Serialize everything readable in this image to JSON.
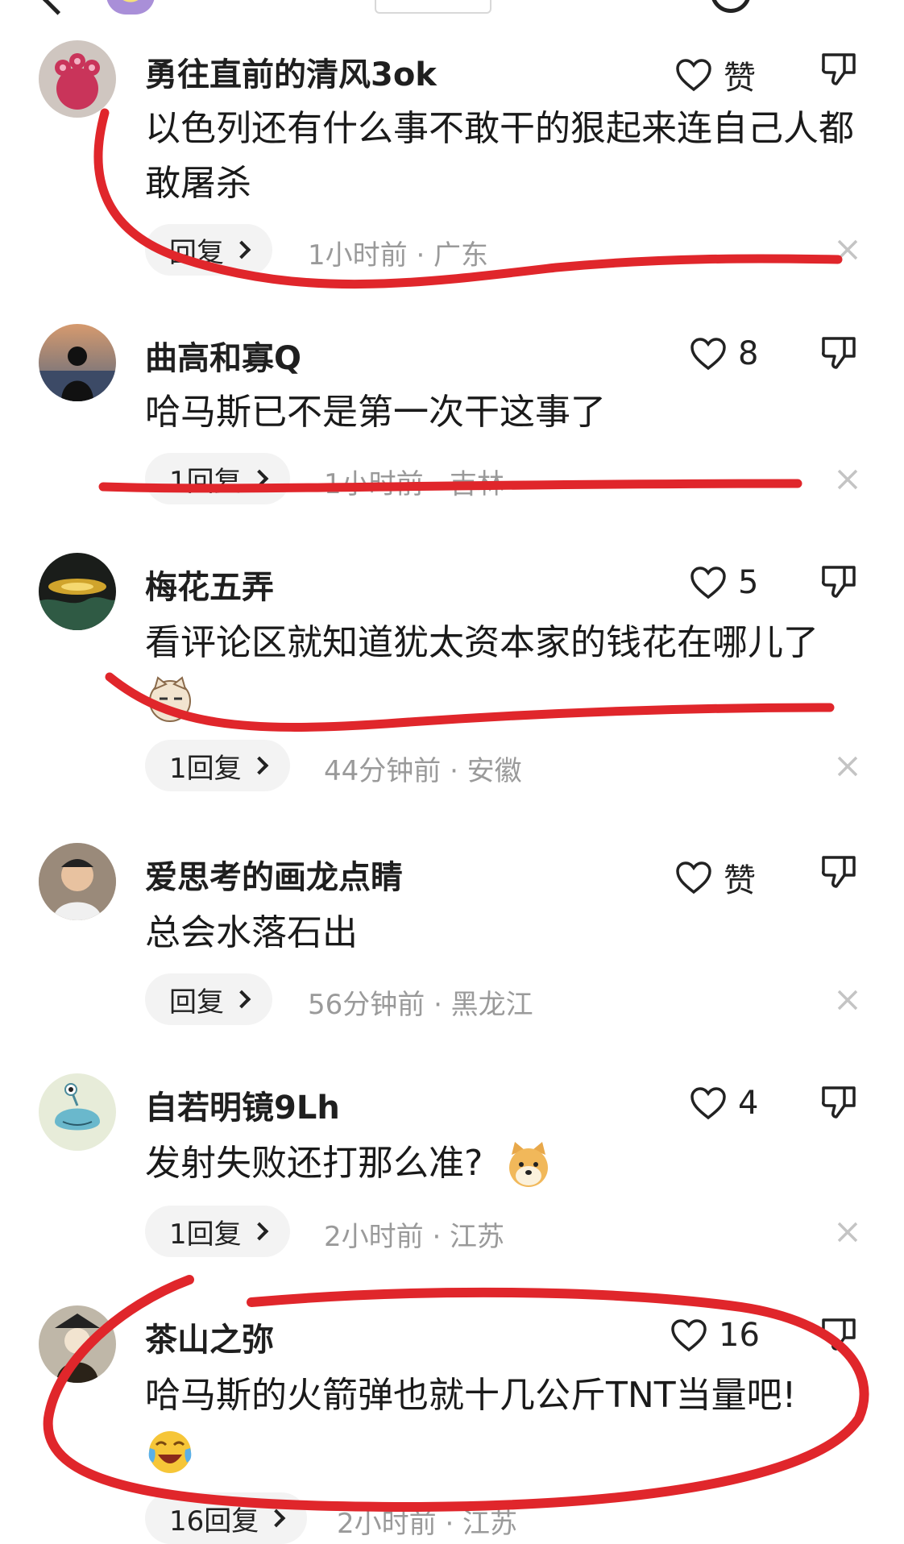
{
  "header": {
    "avatar_icon": "user-avatar-icon",
    "search_icon": "search-icon",
    "back_icon": "back-arrow-icon"
  },
  "comments": [
    {
      "username": "勇往直前的清风3ok",
      "like_label": "赞",
      "text": "以色列还有什么事不敢干的狠起来连自己人都敢屠杀",
      "reply_label": "回复",
      "meta": "1小时前 · 广东",
      "avatar_color": "#c9345a"
    },
    {
      "username": "曲高和寡Q",
      "like_label": "8",
      "text": "哈马斯已不是第一次干这事了",
      "reply_label": "1回复",
      "meta": "1小时前 · 吉林",
      "avatar_color": "#5a6aa0"
    },
    {
      "username": "梅花五弄",
      "like_label": "5",
      "text": "看评论区就知道犹太资本家的钱花在哪儿了",
      "reply_label": "1回复",
      "meta": "44分钟前 · 安徽",
      "avatar_color": "#3a3a1a"
    },
    {
      "username": "爱思考的画龙点睛",
      "like_label": "赞",
      "text": "总会水落石出",
      "reply_label": "回复",
      "meta": "56分钟前 · 黑龙江",
      "avatar_color": "#b8a090"
    },
    {
      "username": "自若明镜9Lh",
      "like_label": "4",
      "text": "发射失败还打那么准?",
      "reply_label": "1回复",
      "meta": "2小时前 · 江苏",
      "avatar_color": "#7bc6d8"
    },
    {
      "username": "茶山之弥",
      "like_label": "16",
      "text": "哈马斯的火箭弹也就十几公斤TNT当量吧!",
      "reply_label": "16回复",
      "meta": "2小时前 · 江苏",
      "avatar_color": "#4a3a2a"
    }
  ],
  "colors": {
    "annotation_red": "#e0262b",
    "meta_gray": "#9a9a9a",
    "pill_bg": "#f3f3f3"
  }
}
